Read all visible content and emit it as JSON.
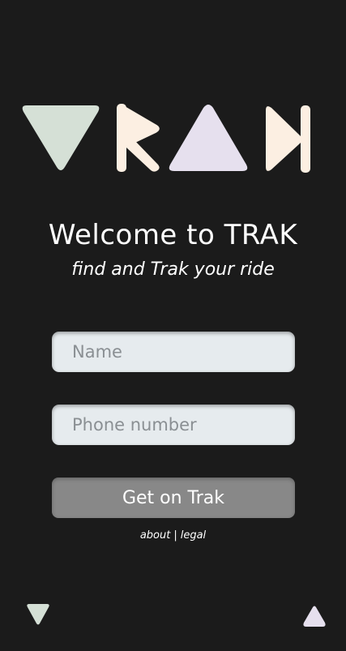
{
  "logo": {
    "alt": "TRAK",
    "colors": {
      "green": "#d5e0d6",
      "cream": "#fcefe2",
      "lavender": "#e6e0ee"
    }
  },
  "header": {
    "title": "Welcome to TRAK",
    "subtitle": "find and Trak your ride"
  },
  "form": {
    "name_placeholder": "Name",
    "phone_placeholder": "Phone number",
    "submit_label": "Get on Trak"
  },
  "footer": {
    "about_label": "about",
    "separator": "|",
    "legal_label": "legal"
  },
  "corners": {
    "left_icon": "triangle-down-icon",
    "right_icon": "triangle-up-icon"
  }
}
